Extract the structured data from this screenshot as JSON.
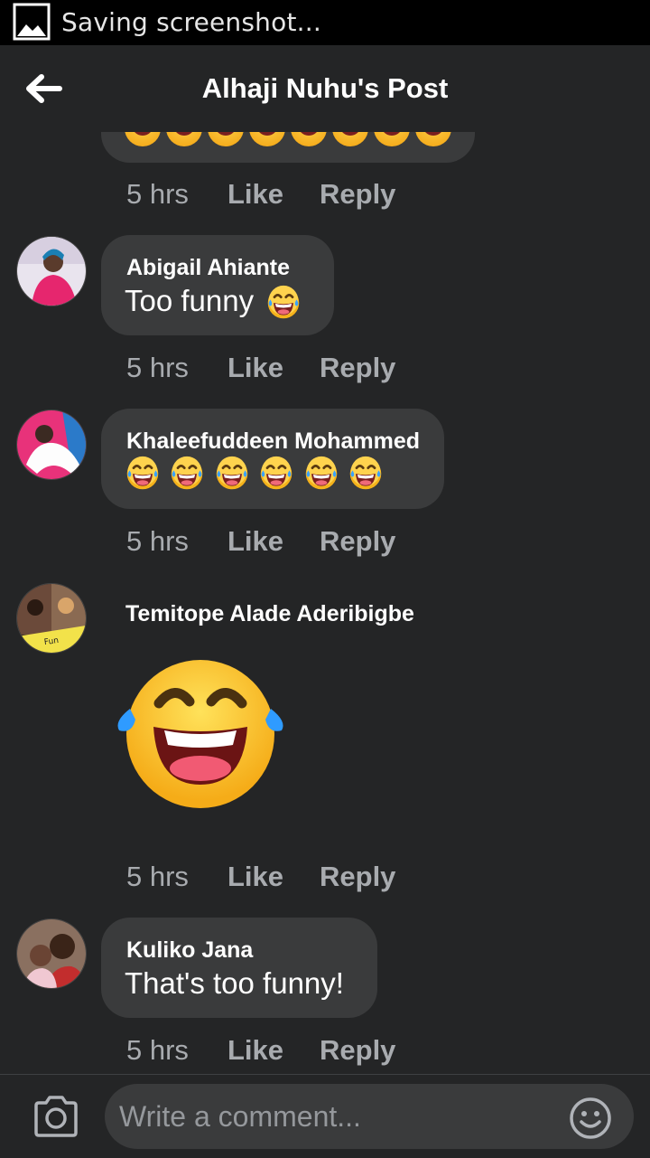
{
  "status_bar": {
    "text": "Saving screenshot..."
  },
  "header": {
    "title": "Alhaji Nuhu's Post"
  },
  "comments": [
    {
      "author": "",
      "text": "",
      "time": "5 hrs",
      "like": "Like",
      "reply": "Reply",
      "emoji_count": 8
    },
    {
      "author": "Abigail Ahiante",
      "text": "Too funny",
      "time": "5 hrs",
      "like": "Like",
      "reply": "Reply",
      "emoji_count": 1
    },
    {
      "author": "Khaleefuddeen Mohammed",
      "text": "",
      "time": "5 hrs",
      "like": "Like",
      "reply": "Reply",
      "emoji_count": 6
    },
    {
      "author": "Temitope Alade Aderibigbe",
      "text": "",
      "time": "5 hrs",
      "like": "Like",
      "reply": "Reply",
      "emoji_count": 1
    },
    {
      "author": "Kuliko Jana",
      "text": "That's too funny!",
      "time": "5 hrs",
      "like": "Like",
      "reply": "Reply",
      "emoji_count": 0
    }
  ],
  "composer": {
    "placeholder": "Write a comment..."
  },
  "icons": {
    "status": "image-icon",
    "back": "back-arrow-icon",
    "camera": "camera-icon",
    "emoji": "smiley-icon",
    "reaction": "laughing-tears-emoji"
  },
  "colors": {
    "background": "#242526",
    "bubble": "#3a3b3c",
    "meta_text": "#a8abaf",
    "status_bar": "#000000"
  }
}
